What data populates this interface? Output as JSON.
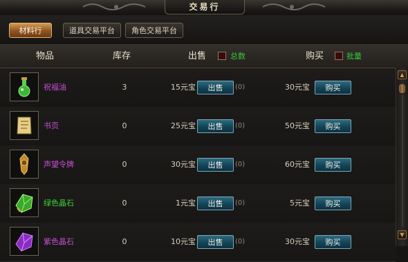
{
  "window": {
    "title": "交易行"
  },
  "tabs": [
    {
      "label": "材料行",
      "active": true
    },
    {
      "label": "道具交易平台",
      "active": false
    },
    {
      "label": "角色交易平台",
      "active": false
    }
  ],
  "header": {
    "col_item": "物品",
    "col_stock": "库存",
    "col_sell": "出售",
    "sell_option_label": "总数",
    "col_buy": "购买",
    "buy_option_label": "批量"
  },
  "items": [
    {
      "name": "祝福油",
      "name_color": "#c84ed6",
      "icon": "blessing-oil-icon",
      "stock": "3",
      "sell_price": "15元宝",
      "sell_button": "出售",
      "sell_count": "(0)",
      "buy_price": "30元宝",
      "buy_button": "购买"
    },
    {
      "name": "书页",
      "name_color": "#c84ed6",
      "icon": "book-page-icon",
      "stock": "0",
      "sell_price": "25元宝",
      "sell_button": "出售",
      "sell_count": "(0)",
      "buy_price": "50元宝",
      "buy_button": "购买"
    },
    {
      "name": "声望令牌",
      "name_color": "#c84ed6",
      "icon": "prestige-token-icon",
      "stock": "0",
      "sell_price": "30元宝",
      "sell_button": "出售",
      "sell_count": "(0)",
      "buy_price": "60元宝",
      "buy_button": "购买"
    },
    {
      "name": "绿色晶石",
      "name_color": "#3fd23a",
      "icon": "green-crystal-icon",
      "stock": "0",
      "sell_price": "1元宝",
      "sell_button": "出售",
      "sell_count": "(0)",
      "buy_price": "5元宝",
      "buy_button": "购买"
    },
    {
      "name": "紫色晶石",
      "name_color": "#c84ed6",
      "icon": "purple-crystal-icon",
      "stock": "0",
      "sell_price": "10元宝",
      "sell_button": "出售",
      "sell_count": "(0)",
      "buy_price": "30元宝",
      "buy_button": "购买"
    }
  ],
  "scrollbar": {
    "up_icon": "scroll-up-icon",
    "down_icon": "scroll-down-icon"
  }
}
